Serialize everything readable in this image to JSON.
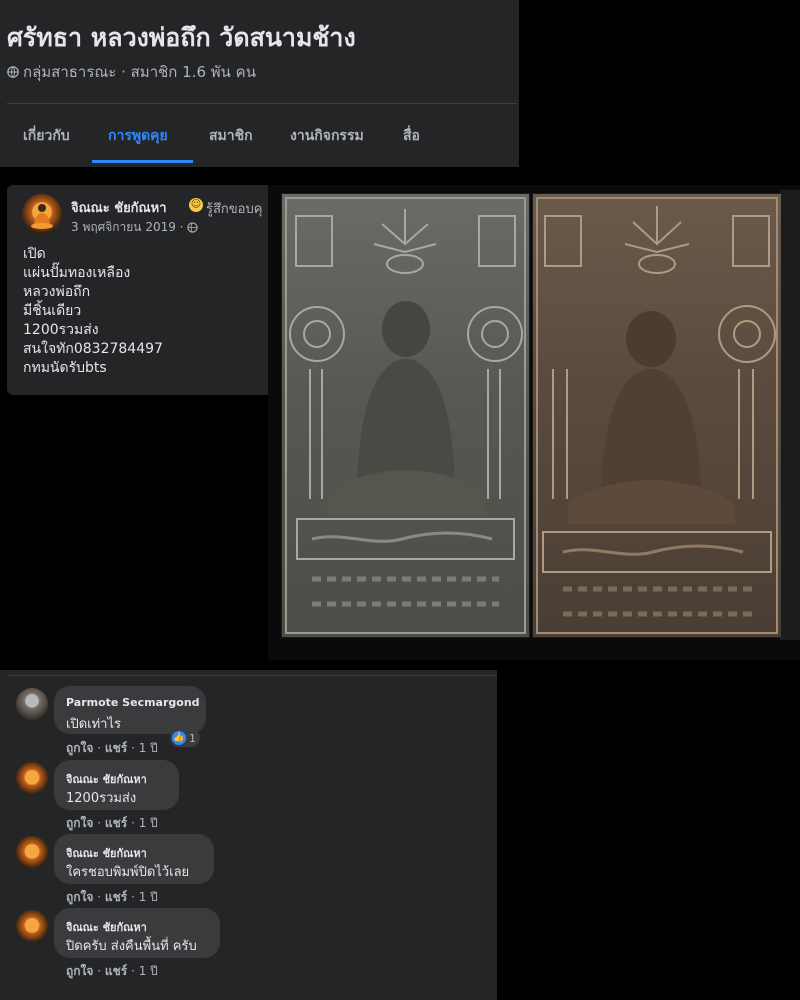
{
  "group": {
    "name": "ศรัทธา หลวงพ่อถึก วัดสนามช้าง",
    "meta": "กลุ่มสาธารณะ · สมาชิก 1.6 พัน คน",
    "tabs": [
      {
        "label": "เกี่ยวกับ",
        "active": false
      },
      {
        "label": "การพูดคุย",
        "active": true
      },
      {
        "label": "สมาชิก",
        "active": false
      },
      {
        "label": "งานกิจกรรม",
        "active": false
      },
      {
        "label": "สื่อ",
        "active": false
      }
    ]
  },
  "post": {
    "author": "จิณณะ ชัยกัณหา",
    "feeling": "รู้สึกขอบคุ",
    "date": "3 พฤศจิกายน 2019 ·",
    "body_lines": [
      "เปิด",
      "แผ่นปั๊มทองเหลือง",
      "หลวงพ่อถึก",
      "มีชิ้นเดียว",
      "1200รวมส่ง",
      "สนใจทัก0832784497",
      "กทมนัดรับbts"
    ]
  },
  "comments": [
    {
      "author": "Parmote Secmargond",
      "text": "เปิดเท่าไร",
      "actions": {
        "like": "ถูกใจ",
        "sep1": "·",
        "share": "แชร์",
        "sep2": "·",
        "time": "1 ปี"
      },
      "reaction_count": "1"
    },
    {
      "author": "จิณณะ ชัยกัณหา",
      "text": "1200รวมส่ง",
      "actions": {
        "like": "ถูกใจ",
        "sep1": "·",
        "share": "แชร์",
        "sep2": "·",
        "time": "1 ปี"
      }
    },
    {
      "author": "จิณณะ ชัยกัณหา",
      "text": "ใครชอบพิมพ์ปิดไว้เลย",
      "actions": {
        "like": "ถูกใจ",
        "sep1": "·",
        "share": "แชร์",
        "sep2": "·",
        "time": "1 ปี"
      }
    },
    {
      "author": "จิณณะ ชัยกัณหา",
      "text": "ปิดครับ ส่งคืนพื้นที่ ครับ",
      "actions": {
        "like": "ถูกใจ",
        "sep1": "·",
        "share": "แชร์",
        "sep2": "·",
        "time": "1 ปี"
      }
    }
  ],
  "colors": {
    "accent": "#2d88ff",
    "card": "#242526",
    "bubble": "#3a3b3c"
  }
}
